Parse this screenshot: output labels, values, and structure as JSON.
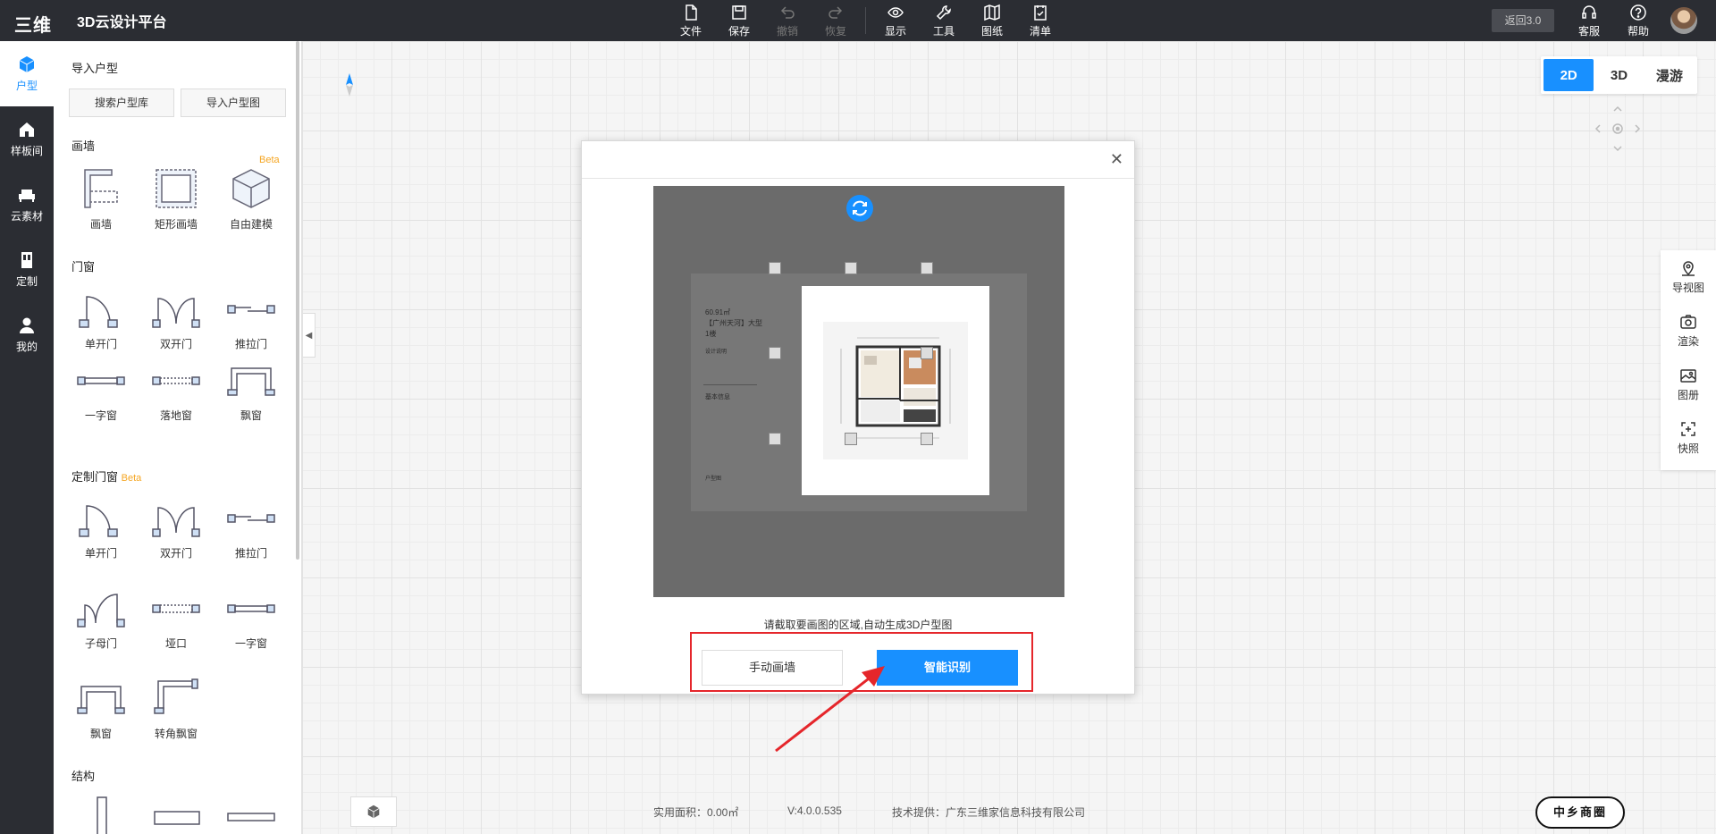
{
  "app": {
    "logo_text": "三维家",
    "title": "3D云设计平台"
  },
  "toolbar": {
    "items": [
      {
        "label": "文件",
        "icon": "file-icon",
        "enabled": true
      },
      {
        "label": "保存",
        "icon": "save-icon",
        "enabled": true
      },
      {
        "label": "撤销",
        "icon": "undo-icon",
        "enabled": false
      },
      {
        "label": "恢复",
        "icon": "redo-icon",
        "enabled": false
      },
      {
        "label": "显示",
        "icon": "eye-icon",
        "enabled": true
      },
      {
        "label": "工具",
        "icon": "wrench-icon",
        "enabled": true
      },
      {
        "label": "图纸",
        "icon": "map-icon",
        "enabled": true
      },
      {
        "label": "清单",
        "icon": "checklist-icon",
        "enabled": true
      }
    ],
    "return_label": "返回3.0",
    "service_label": "客服",
    "help_label": "帮助"
  },
  "leftnav": {
    "items": [
      {
        "label": "户型",
        "icon": "cube-icon",
        "active": true
      },
      {
        "label": "样板间",
        "icon": "house-icon",
        "active": false
      },
      {
        "label": "云素材",
        "icon": "sofa-icon",
        "active": false
      },
      {
        "label": "定制",
        "icon": "cabinet-icon",
        "active": false
      },
      {
        "label": "我的",
        "icon": "user-icon",
        "active": false
      }
    ]
  },
  "panel": {
    "import_title": "导入户型",
    "search_btn": "搜索户型库",
    "import_btn": "导入户型图",
    "draw_wall_title": "画墙",
    "beta_label": "Beta",
    "draw_wall_items": [
      "画墙",
      "矩形画墙",
      "自由建模"
    ],
    "doors_title": "门窗",
    "doors_items": [
      "单开门",
      "双开门",
      "推拉门",
      "一字窗",
      "落地窗",
      "飘窗"
    ],
    "custom_doors_title": "定制门窗",
    "custom_doors_items": [
      "单开门",
      "双开门",
      "推拉门",
      "子母门",
      "垭口",
      "一字窗",
      "飘窗",
      "转角飘窗"
    ],
    "structure_title": "结构"
  },
  "view": {
    "buttons": [
      "2D",
      "3D",
      "漫游"
    ],
    "active": "2D"
  },
  "rightbar": {
    "items": [
      {
        "label": "导视图",
        "icon": "location-icon"
      },
      {
        "label": "渲染",
        "icon": "camera-icon"
      },
      {
        "label": "图册",
        "icon": "album-icon"
      },
      {
        "label": "快照",
        "icon": "snapshot-icon"
      }
    ]
  },
  "modal": {
    "doc_lines": [
      "60.91㎡",
      "【广州天河】大型",
      "1楼",
      "设计说明",
      "基本信息",
      "户型图"
    ],
    "hint": "请截取要画图的区域,自动生成3D户型图",
    "manual_btn": "手动画墙",
    "smart_btn": "智能识别"
  },
  "status": {
    "area": "实用面积：0.00㎡",
    "version": "V:4.0.0.535",
    "provider": "技术提供：广东三维家信息科技有限公司"
  },
  "brand_badge": "中乡商圈",
  "colors": {
    "topbar": "#2b2d33",
    "accent": "#1890ff",
    "highlight": "#e5262b",
    "beta": "#f5a623"
  }
}
